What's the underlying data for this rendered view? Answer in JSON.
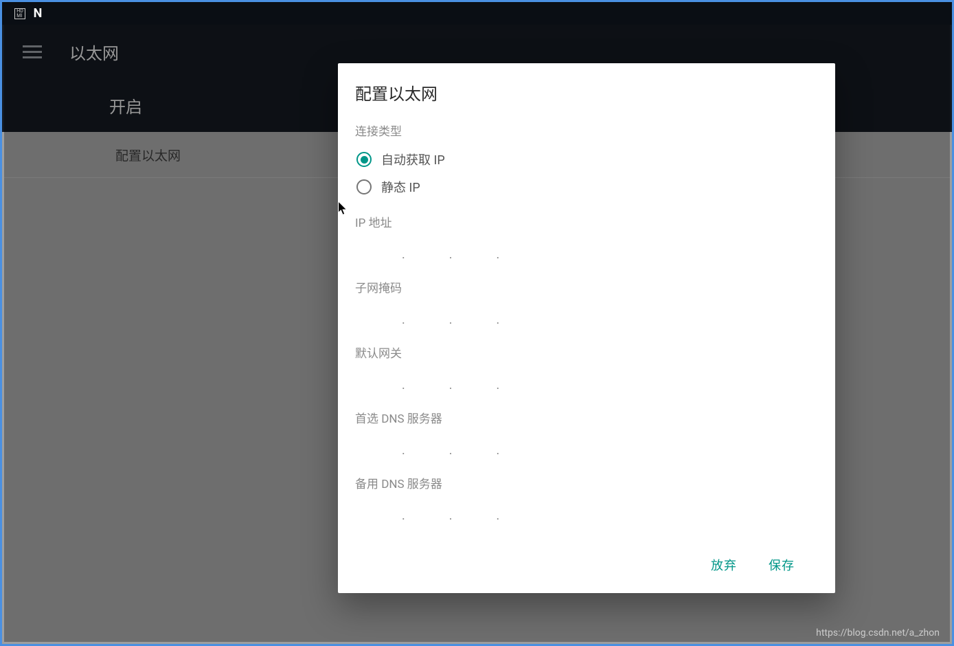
{
  "appbar": {
    "title": "以太网"
  },
  "sub_header": {
    "title": "开启"
  },
  "list": {
    "configure_label": "配置以太网"
  },
  "dialog": {
    "title": "配置以太网",
    "connection_type_label": "连接类型",
    "radio_auto": "自动获取 IP",
    "radio_static": "静态 IP",
    "ip_address_label": "IP 地址",
    "subnet_mask_label": "子网掩码",
    "gateway_label": "默认网关",
    "dns_primary_label": "首选 DNS 服务器",
    "dns_secondary_label": "备用 DNS 服务器",
    "btn_cancel": "放弃",
    "btn_save": "保存",
    "ip_fields": {
      "ip_address": [
        "",
        "",
        "",
        ""
      ],
      "subnet_mask": [
        "",
        "",
        "",
        ""
      ],
      "gateway": [
        "",
        "",
        "",
        ""
      ],
      "dns_primary": [
        "",
        "",
        "",
        ""
      ],
      "dns_secondary": [
        "",
        "",
        "",
        ""
      ]
    },
    "selected_connection": "auto"
  },
  "watermark": "https://blog.csdn.net/a_zhon",
  "colors": {
    "accent": "#009688",
    "appbar_bg": "#14181f",
    "statusbar_bg": "#0a0e14"
  }
}
